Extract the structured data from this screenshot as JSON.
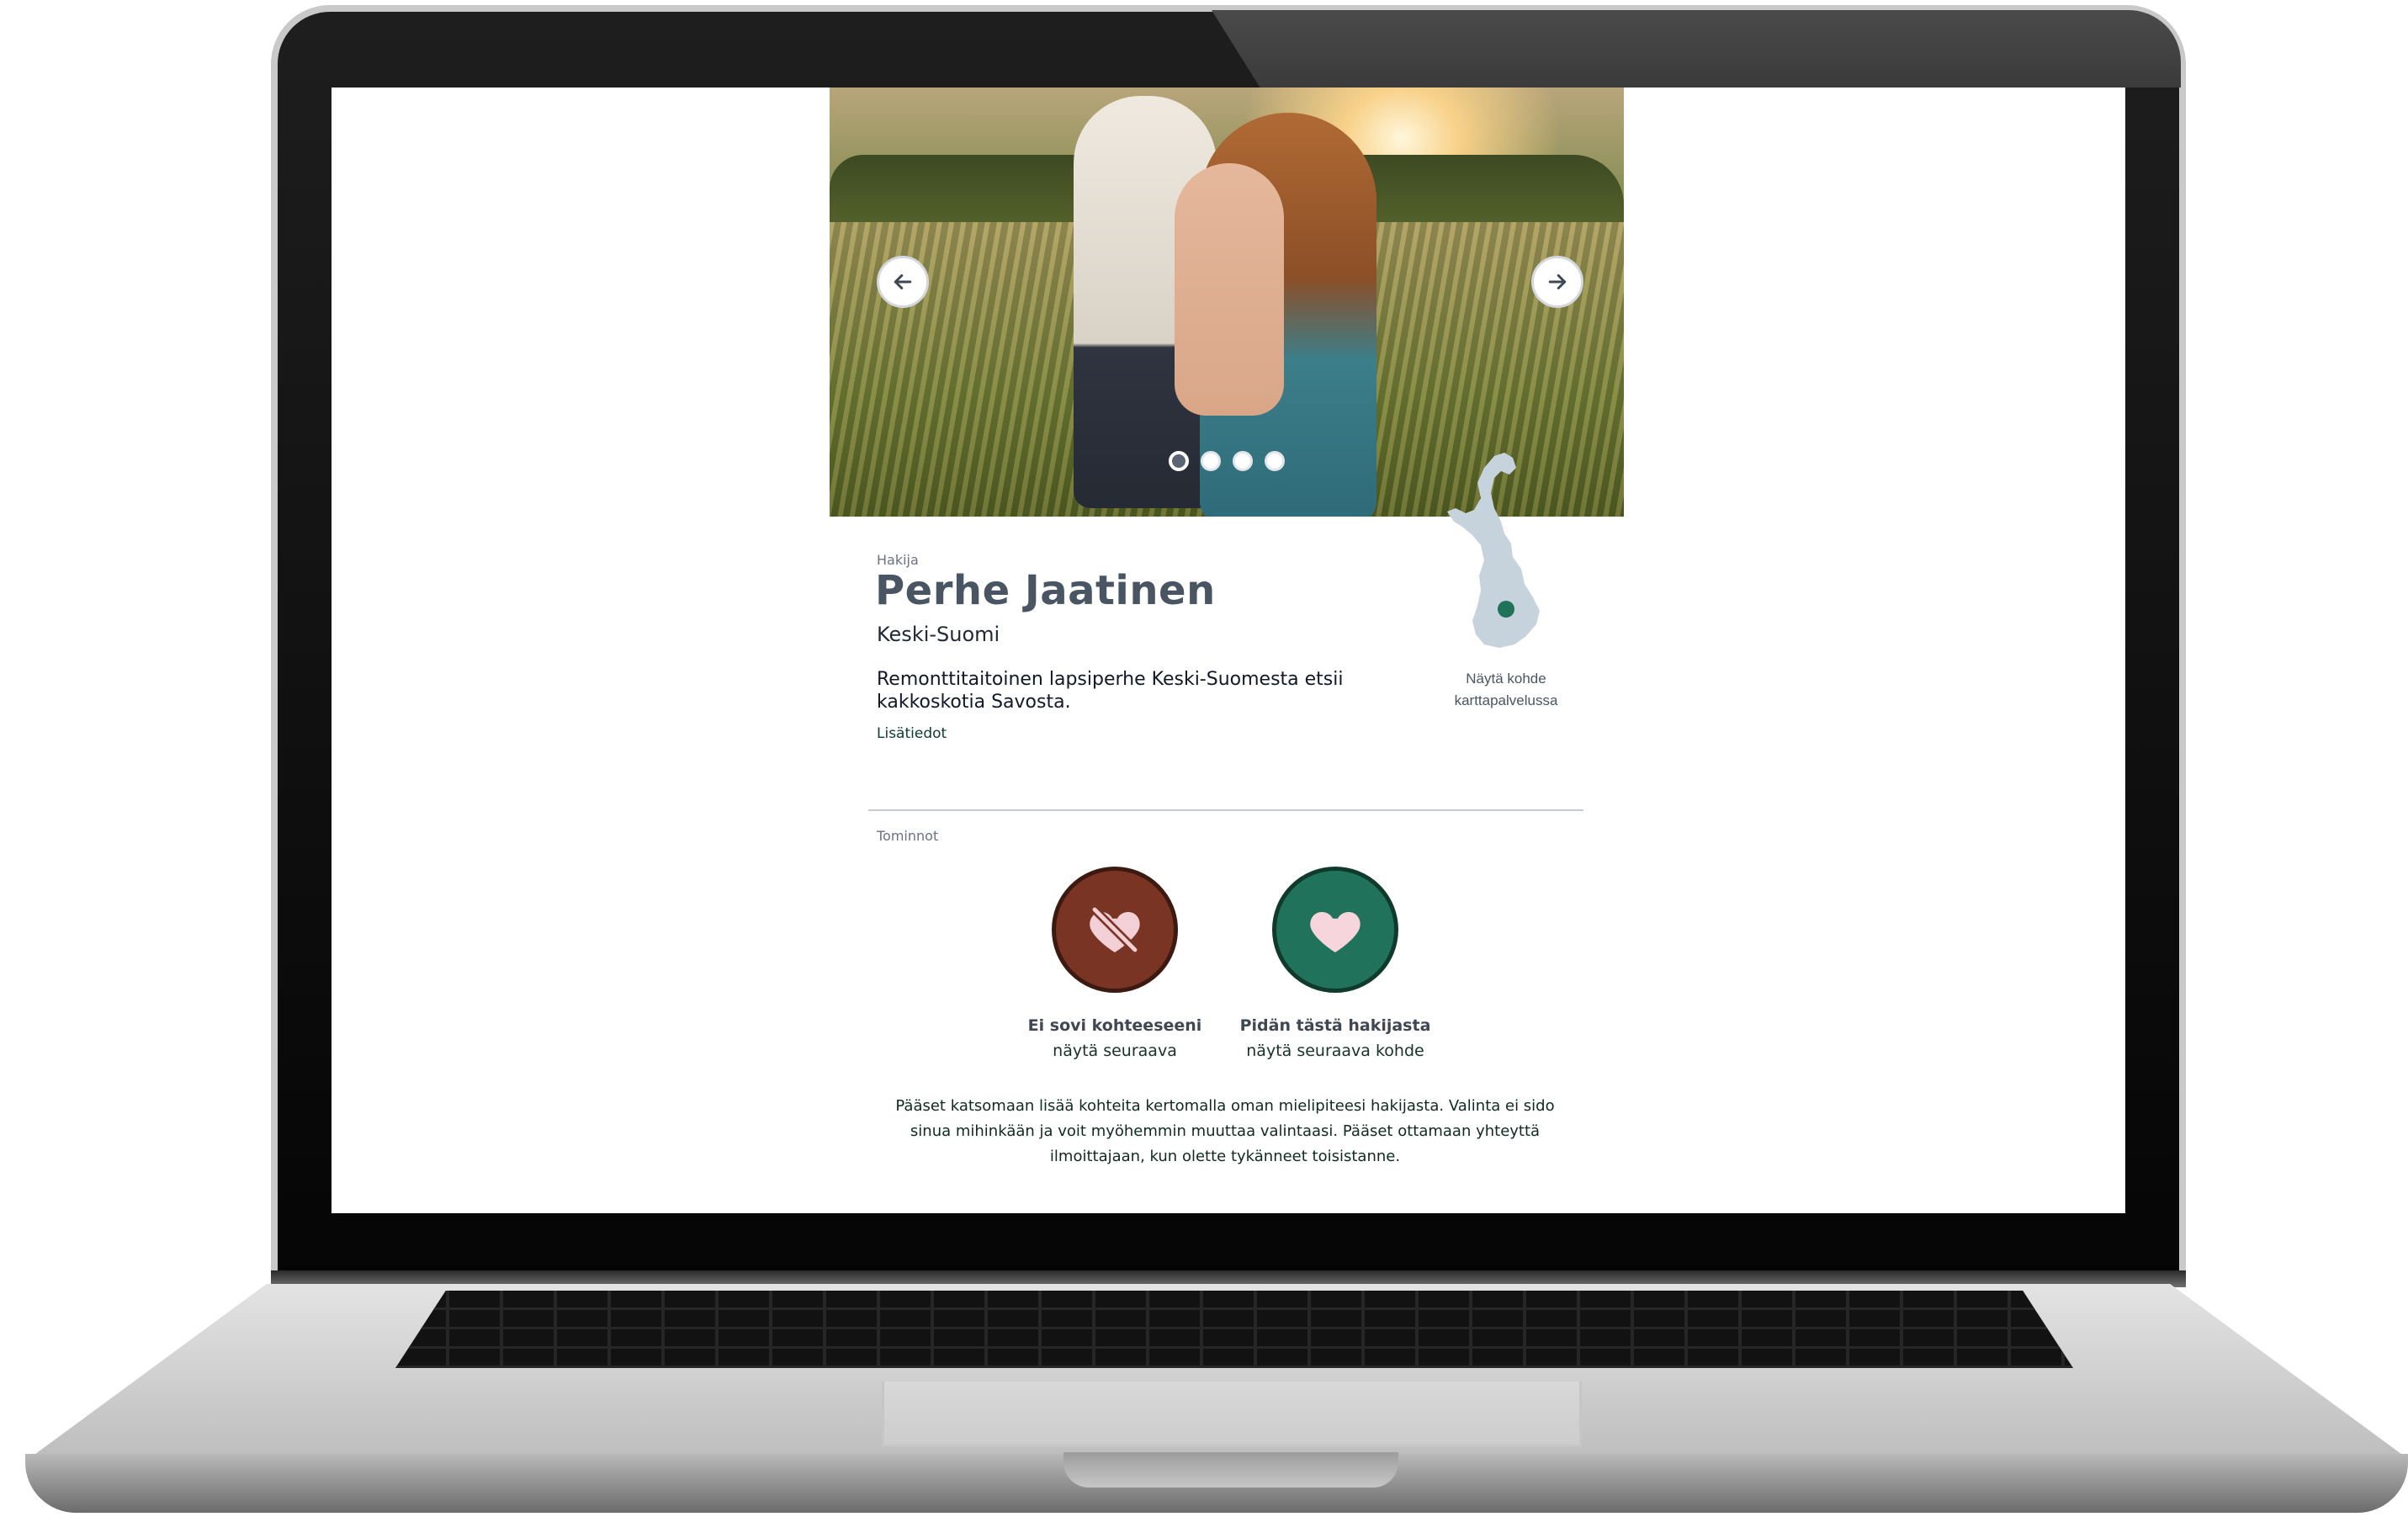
{
  "carousel": {
    "prev_icon": "arrow-left-icon",
    "next_icon": "arrow-right-icon",
    "slide_count": 4,
    "active_slide": 1
  },
  "applicant": {
    "label": "Hakija",
    "name": "Perhe Jaatinen",
    "region": "Keski-Suomi",
    "description": "Remonttitaitoinen lapsiperhe Keski-Suomesta etsii kakkoskotia Savosta.",
    "more_link": "Lisätiedot"
  },
  "map": {
    "caption": "Näytä kohde karttapalvelussa",
    "marker_color": "#20735a",
    "map_color": "#c7d3dc"
  },
  "actions": {
    "section_label": "Tominnot",
    "dislike": {
      "title": "Ei sovi kohteeseeni",
      "subtitle": "näytä seuraava",
      "icon": "heart-crossed-icon",
      "color": "#7a3424"
    },
    "like": {
      "title": "Pidän tästä hakijasta",
      "subtitle": "näytä seuraava kohde",
      "icon": "heart-icon",
      "color": "#20735a"
    }
  },
  "footer_text": "Pääset katsomaan lisää kohteita kertomalla oman mielipiteesi hakijasta. Valinta ei sido sinua mihinkään ja voit myöhemmin muuttaa valintaasi. Pääset ottamaan yhteyttä ilmoittajaan, kun olette tykänneet toisistanne."
}
